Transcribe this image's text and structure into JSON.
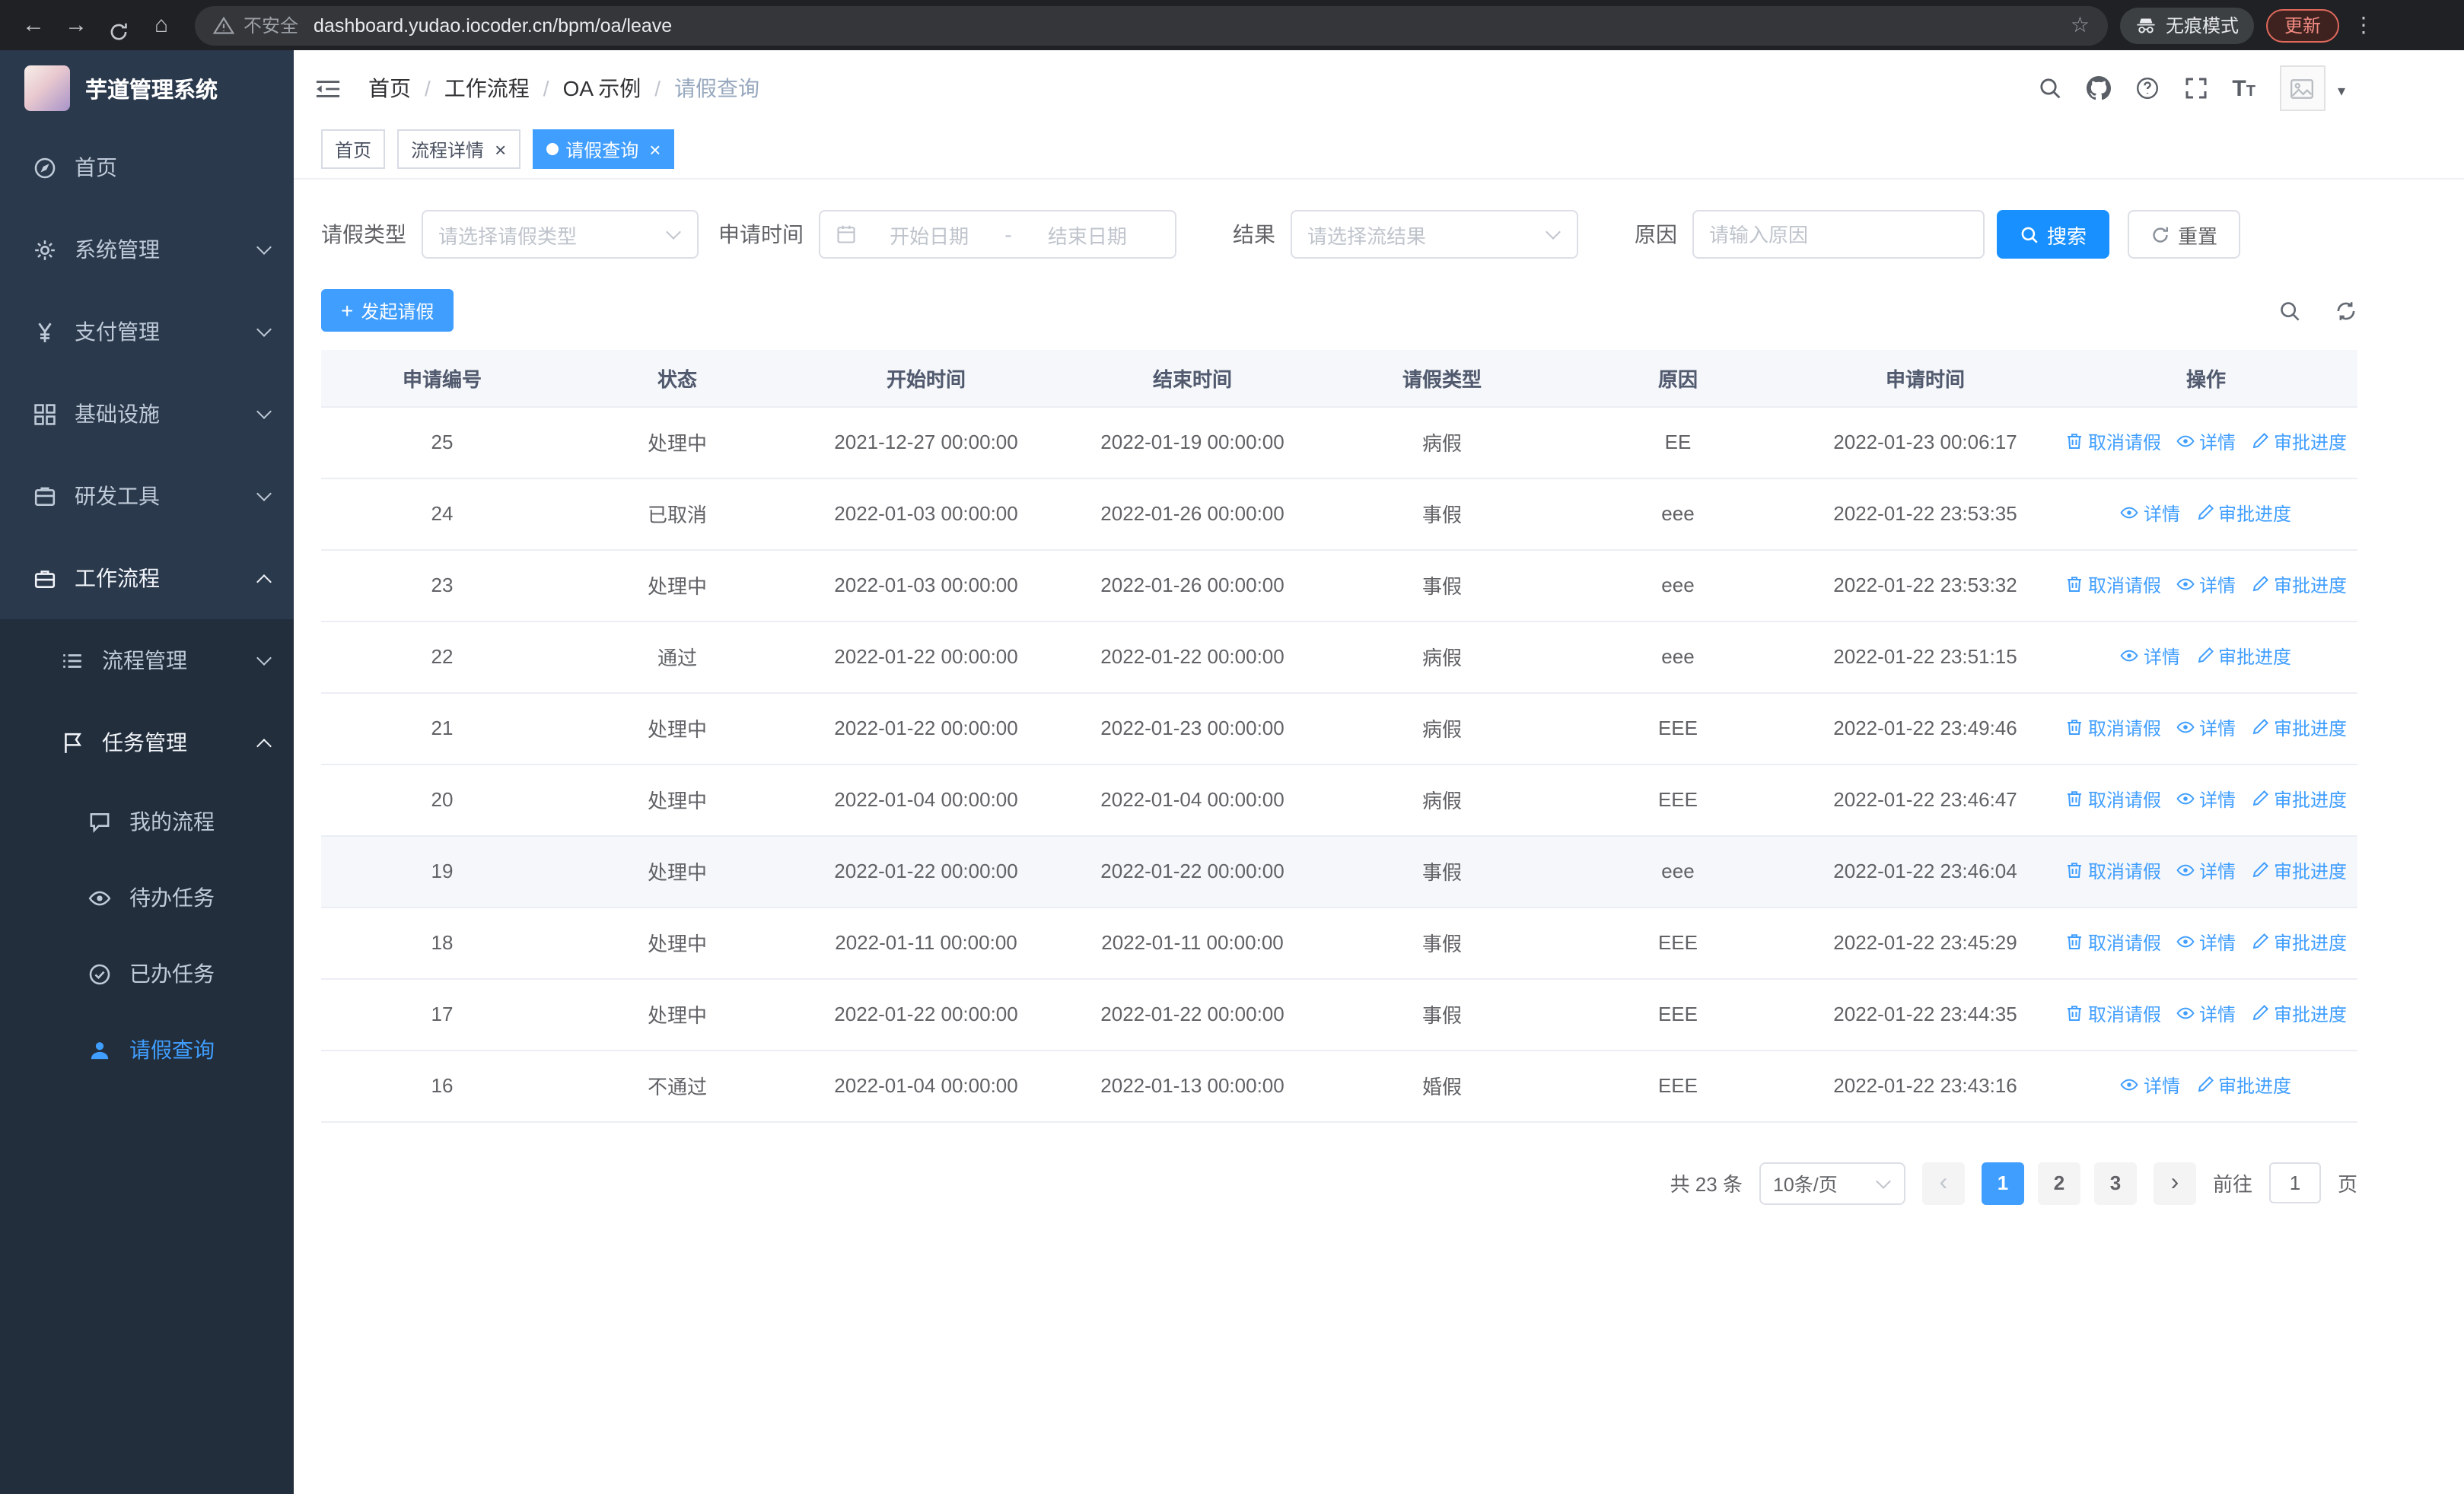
{
  "browser": {
    "security_label": "不安全",
    "url": "dashboard.yudao.iocoder.cn/bpm/oa/leave",
    "incognito_label": "无痕模式",
    "update_label": "更新"
  },
  "sidebar": {
    "logo_title": "芋道管理系统",
    "items": [
      {
        "slug": "home",
        "icon": "dashboard-icon",
        "label": "首页",
        "level": 1
      },
      {
        "slug": "system-management",
        "icon": "gear-icon",
        "label": "系统管理",
        "level": 1,
        "chevron": "down"
      },
      {
        "slug": "payment-management",
        "icon": "yen-icon",
        "label": "支付管理",
        "level": 1,
        "chevron": "down"
      },
      {
        "slug": "infrastructure",
        "icon": "grid-icon",
        "label": "基础设施",
        "level": 1,
        "chevron": "down"
      },
      {
        "slug": "dev-tools",
        "icon": "toolbox-icon",
        "label": "研发工具",
        "level": 1,
        "chevron": "down"
      },
      {
        "slug": "workflow",
        "icon": "briefcase-icon",
        "label": "工作流程",
        "level": 1,
        "chevron": "up",
        "expanded": true
      },
      {
        "slug": "process-management",
        "icon": "list-icon",
        "label": "流程管理",
        "level": 2,
        "chevron": "down"
      },
      {
        "slug": "task-management",
        "icon": "flag-icon",
        "label": "任务管理",
        "level": 2,
        "chevron": "up",
        "expanded": true
      },
      {
        "slug": "my-processes",
        "icon": "chat-icon",
        "label": "我的流程",
        "level": 3
      },
      {
        "slug": "todo-tasks",
        "icon": "eye-icon",
        "label": "待办任务",
        "level": 3
      },
      {
        "slug": "done-tasks",
        "icon": "check-circle-icon",
        "label": "已办任务",
        "level": 3
      },
      {
        "slug": "leave-query",
        "icon": "user-icon",
        "label": "请假查询",
        "level": 3,
        "active": true
      }
    ]
  },
  "header": {
    "breadcrumb": [
      "首页",
      "工作流程",
      "OA 示例",
      "请假查询"
    ],
    "separator": "/"
  },
  "tabs": [
    {
      "label": "首页",
      "closable": false,
      "active": false
    },
    {
      "label": "流程详情",
      "closable": true,
      "active": false
    },
    {
      "label": "请假查询",
      "closable": true,
      "active": true
    }
  ],
  "filters": {
    "type_label": "请假类型",
    "type_placeholder": "请选择请假类型",
    "time_label": "申请时间",
    "date_start_placeholder": "开始日期",
    "date_separator": "-",
    "date_end_placeholder": "结束日期",
    "result_label": "结果",
    "result_placeholder": "请选择流结果",
    "reason_label": "原因",
    "reason_placeholder": "请输入原因",
    "search_label": "搜索",
    "reset_label": "重置"
  },
  "toolbar": {
    "create_label": "发起请假"
  },
  "table": {
    "columns": [
      "申请编号",
      "状态",
      "开始时间",
      "结束时间",
      "请假类型",
      "原因",
      "申请时间",
      "操作"
    ],
    "actions": {
      "cancel": "取消请假",
      "detail": "详情",
      "progress": "审批进度"
    },
    "rows": [
      {
        "id": "25",
        "status": "处理中",
        "start": "2021-12-27 00:00:00",
        "end": "2022-01-19 00:00:00",
        "type": "病假",
        "reason": "EE",
        "apply_time": "2022-01-23 00:06:17",
        "can_cancel": true,
        "highlight": false
      },
      {
        "id": "24",
        "status": "已取消",
        "start": "2022-01-03 00:00:00",
        "end": "2022-01-26 00:00:00",
        "type": "事假",
        "reason": "eee",
        "apply_time": "2022-01-22 23:53:35",
        "can_cancel": false,
        "highlight": false
      },
      {
        "id": "23",
        "status": "处理中",
        "start": "2022-01-03 00:00:00",
        "end": "2022-01-26 00:00:00",
        "type": "事假",
        "reason": "eee",
        "apply_time": "2022-01-22 23:53:32",
        "can_cancel": true,
        "highlight": false
      },
      {
        "id": "22",
        "status": "通过",
        "start": "2022-01-22 00:00:00",
        "end": "2022-01-22 00:00:00",
        "type": "病假",
        "reason": "eee",
        "apply_time": "2022-01-22 23:51:15",
        "can_cancel": false,
        "highlight": false
      },
      {
        "id": "21",
        "status": "处理中",
        "start": "2022-01-22 00:00:00",
        "end": "2022-01-23 00:00:00",
        "type": "病假",
        "reason": "EEE",
        "apply_time": "2022-01-22 23:49:46",
        "can_cancel": true,
        "highlight": false
      },
      {
        "id": "20",
        "status": "处理中",
        "start": "2022-01-04 00:00:00",
        "end": "2022-01-04 00:00:00",
        "type": "病假",
        "reason": "EEE",
        "apply_time": "2022-01-22 23:46:47",
        "can_cancel": true,
        "highlight": false
      },
      {
        "id": "19",
        "status": "处理中",
        "start": "2022-01-22 00:00:00",
        "end": "2022-01-22 00:00:00",
        "type": "事假",
        "reason": "eee",
        "apply_time": "2022-01-22 23:46:04",
        "can_cancel": true,
        "highlight": true
      },
      {
        "id": "18",
        "status": "处理中",
        "start": "2022-01-11 00:00:00",
        "end": "2022-01-11 00:00:00",
        "type": "事假",
        "reason": "EEE",
        "apply_time": "2022-01-22 23:45:29",
        "can_cancel": true,
        "highlight": false
      },
      {
        "id": "17",
        "status": "处理中",
        "start": "2022-01-22 00:00:00",
        "end": "2022-01-22 00:00:00",
        "type": "事假",
        "reason": "EEE",
        "apply_time": "2022-01-22 23:44:35",
        "can_cancel": true,
        "highlight": false
      },
      {
        "id": "16",
        "status": "不通过",
        "start": "2022-01-04 00:00:00",
        "end": "2022-01-13 00:00:00",
        "type": "婚假",
        "reason": "EEE",
        "apply_time": "2022-01-22 23:43:16",
        "can_cancel": false,
        "highlight": false
      }
    ]
  },
  "pagination": {
    "total_label": "共 23 条",
    "page_size": "10条/页",
    "pages": [
      "1",
      "2",
      "3"
    ],
    "active_page": "1",
    "goto_label": "前往",
    "goto_value": "1",
    "goto_suffix": "页"
  },
  "colors": {
    "accent": "#409eff",
    "primary_button": "#1890ff",
    "sidebar_bg": "#2b394c",
    "submenu_bg": "#222e3c",
    "chrome_bg": "#202124"
  }
}
